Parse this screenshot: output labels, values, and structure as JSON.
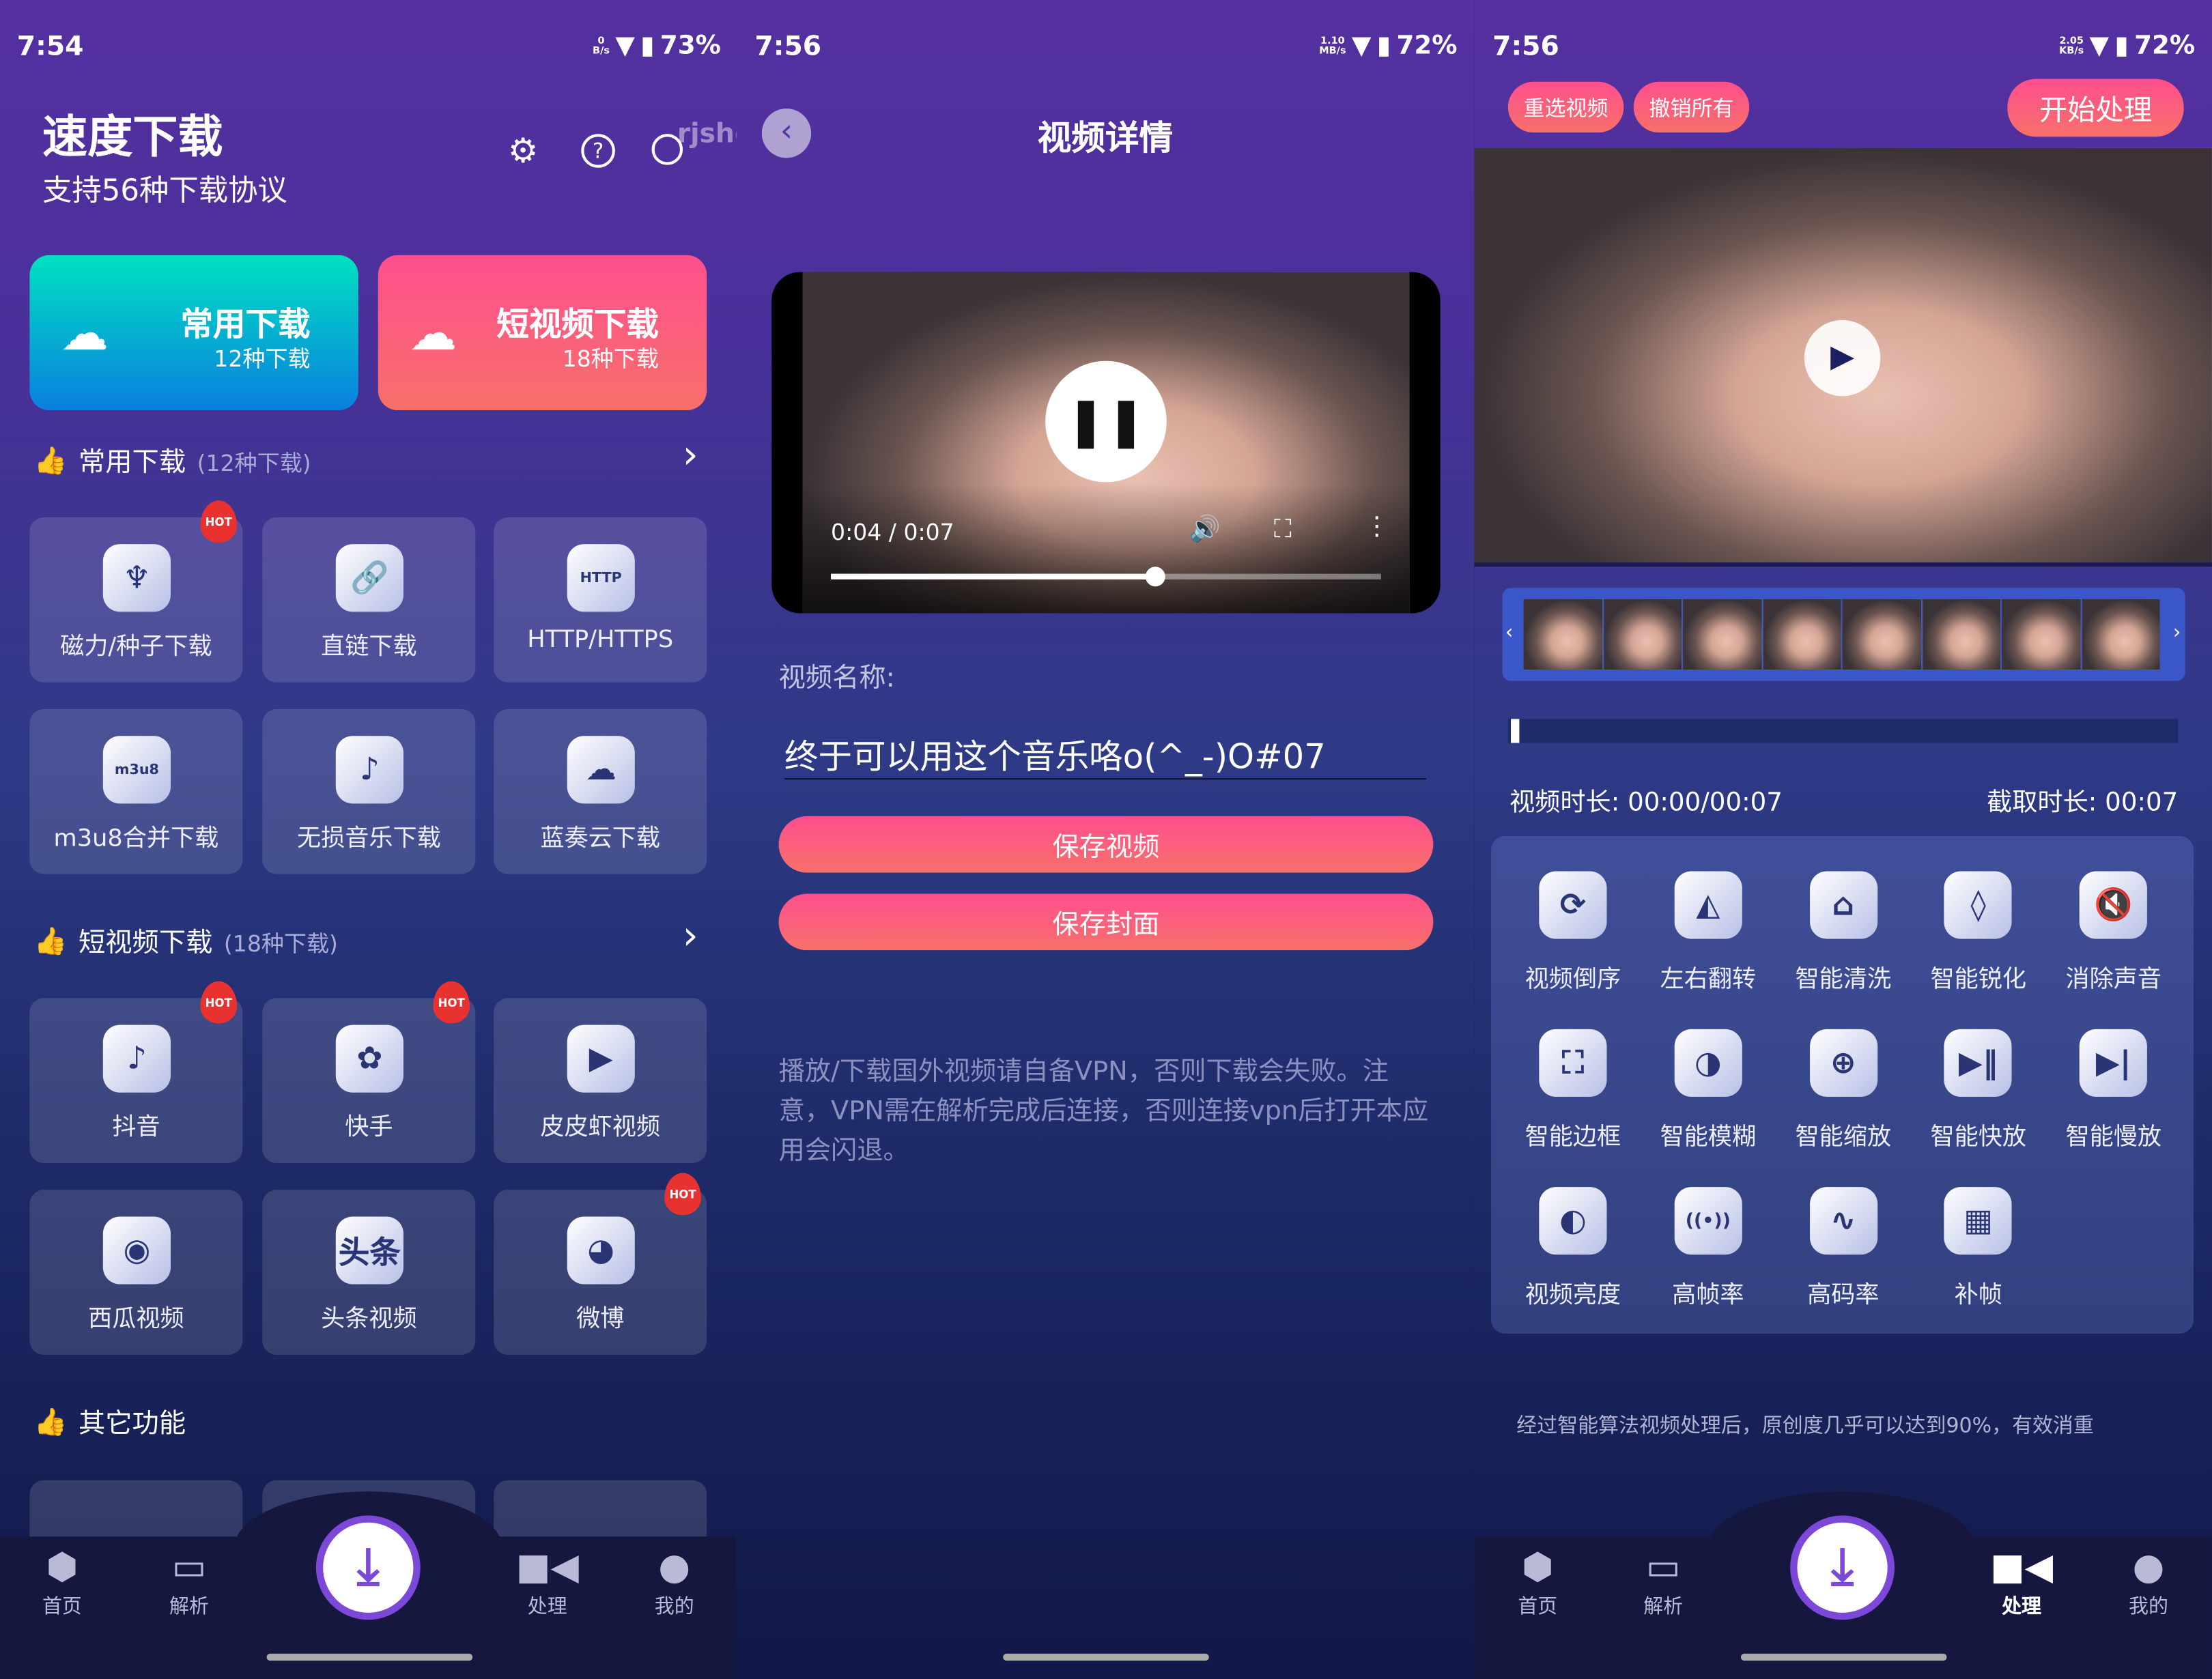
{
  "colors": {
    "bg_top": "#5530a0",
    "bg_bottom": "#111848",
    "accent_pink": "#ff4f8e",
    "accent_teal": "#00dcc0",
    "fab_ring": "#7b48d8"
  },
  "panel1": {
    "status": {
      "time": "7:54",
      "net_speed": "0",
      "net_unit": "B/s",
      "battery": "73%"
    },
    "title": "速度下载",
    "subtitle": "支持56种下载协议",
    "header_icons": [
      "gear-icon",
      "help-icon",
      "search-icon"
    ],
    "watermark": "rjshe.com",
    "cards": [
      {
        "title": "常用下载",
        "sub": "12种下载"
      },
      {
        "title": "短视频下载",
        "sub": "18种下载"
      }
    ],
    "sections": [
      {
        "title": "常用下载",
        "count": "(12种下载)",
        "items": [
          {
            "label": "磁力/种子下载",
            "icon": "seedling-icon",
            "glyph": "♆",
            "hot": "HOT"
          },
          {
            "label": "直链下载",
            "icon": "link-icon",
            "glyph": "🔗"
          },
          {
            "label": "HTTP/HTTPS",
            "icon": "http-icon",
            "glyph": "HTTP"
          },
          {
            "label": "m3u8合并下载",
            "icon": "m3u8-icon",
            "glyph": "m3u8"
          },
          {
            "label": "无损音乐下载",
            "icon": "music-icon",
            "glyph": "♪"
          },
          {
            "label": "蓝奏云下载",
            "icon": "cloud-icon",
            "glyph": "☁"
          }
        ]
      },
      {
        "title": "短视频下载",
        "count": "(18种下载)",
        "items": [
          {
            "label": "抖音",
            "icon": "douyin-icon",
            "glyph": "♪",
            "hot": "HOT"
          },
          {
            "label": "快手",
            "icon": "kuaishou-icon",
            "glyph": "✿",
            "hot": "HOT"
          },
          {
            "label": "皮皮虾视频",
            "icon": "play-icon",
            "glyph": "▶"
          },
          {
            "label": "西瓜视频",
            "icon": "xigua-icon",
            "glyph": "◉"
          },
          {
            "label": "头条视频",
            "icon": "toutiao-icon",
            "glyph": "头条"
          },
          {
            "label": "微博",
            "icon": "weibo-icon",
            "glyph": "◕",
            "hot": "HOT"
          }
        ]
      },
      {
        "title": "其它功能",
        "count": ""
      }
    ]
  },
  "panel2": {
    "status": {
      "time": "7:56",
      "net_speed": "1.10",
      "net_unit": "MB/s",
      "battery": "72%"
    },
    "title": "视频详情",
    "player": {
      "current": "0:04 / 0:07",
      "progress": 0.59
    },
    "name_label": "视频名称:",
    "name_value": "终于可以用这个音乐咯o(^_-)O#07",
    "save_video": "保存视频",
    "save_cover": "保存封面",
    "note": "播放/下载国外视频请自备VPN，否则下载会失败。注意，VPN需在解析完成后连接，否则连接vpn后打开本应用会闪退。"
  },
  "panel3": {
    "status": {
      "time": "7:56",
      "net_speed": "2.05",
      "net_unit": "KB/s",
      "battery": "72%"
    },
    "reselect": "重选视频",
    "undo_all": "撤销所有",
    "start": "开始处理",
    "duration_label": "视频时长: 00:00/00:07",
    "clip_label": "截取时长: 00:07",
    "tools": [
      {
        "label": "视频倒序",
        "icon": "refresh-icon",
        "glyph": "⟳"
      },
      {
        "label": "左右翻转",
        "icon": "flip-icon",
        "glyph": "◭"
      },
      {
        "label": "智能清洗",
        "icon": "broom-icon",
        "glyph": "⌂"
      },
      {
        "label": "智能锐化",
        "icon": "drop-icon",
        "glyph": "◊"
      },
      {
        "label": "消除声音",
        "icon": "mute-icon",
        "glyph": "🔇"
      },
      {
        "label": "智能边框",
        "icon": "frame-icon",
        "glyph": "⛶"
      },
      {
        "label": "智能模糊",
        "icon": "blur-icon",
        "glyph": "◑"
      },
      {
        "label": "智能缩放",
        "icon": "zoom-in-icon",
        "glyph": "⊕"
      },
      {
        "label": "智能快放",
        "icon": "play-pause-icon",
        "glyph": "▶‖"
      },
      {
        "label": "智能慢放",
        "icon": "skip-icon",
        "glyph": "▶|"
      },
      {
        "label": "视频亮度",
        "icon": "brightness-icon",
        "glyph": "◐"
      },
      {
        "label": "高帧率",
        "icon": "broadcast-icon",
        "glyph": "((•))"
      },
      {
        "label": "高码率",
        "icon": "pulse-icon",
        "glyph": "∿"
      },
      {
        "label": "补帧",
        "icon": "film-icon",
        "glyph": "▦"
      }
    ],
    "footer": "经过智能算法视频处理后，原创度几乎可以达到90%，有效消重"
  },
  "nav": [
    {
      "label": "首页",
      "icon": "home-cube-icon"
    },
    {
      "label": "解析",
      "icon": "folder-icon"
    },
    {
      "label": "",
      "icon": "download-icon"
    },
    {
      "label": "处理",
      "icon": "video-camera-icon"
    },
    {
      "label": "我的",
      "icon": "user-icon"
    }
  ],
  "nav_active_panel3": "处理"
}
